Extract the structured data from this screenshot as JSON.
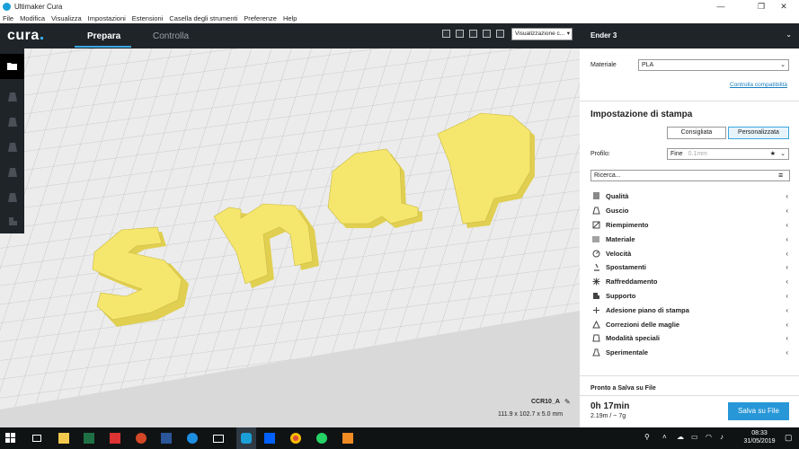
{
  "window": {
    "title": "Ultimaker Cura",
    "minimize": "—",
    "maximize": "❐",
    "close": "✕"
  },
  "menu": [
    "File",
    "Modifica",
    "Visualizza",
    "Impostazioni",
    "Estensioni",
    "Casella degli strumenti",
    "Preferenze",
    "Help"
  ],
  "header": {
    "logo": "cura",
    "stages": {
      "prepare": "Prepara",
      "monitor": "Controlla"
    },
    "view_select": "Visualizzazione c..."
  },
  "printer": {
    "name": "Ender 3"
  },
  "material": {
    "label": "Materiale",
    "value": "PLA",
    "compat_link": "Controlla compatibilità"
  },
  "print_setup": {
    "title": "Impostazione di stampa",
    "modes": {
      "recommended": "Consigliata",
      "custom": "Personalizzata"
    },
    "profile_label": "Profilo:",
    "profile_value": "Fine",
    "profile_extra": "0.1mm",
    "search_placeholder": "Ricerca...",
    "categories": [
      {
        "name": "Qualità",
        "icon": "quality-icon"
      },
      {
        "name": "Guscio",
        "icon": "shell-icon"
      },
      {
        "name": "Riempimento",
        "icon": "infill-icon"
      },
      {
        "name": "Materiale",
        "icon": "material-icon"
      },
      {
        "name": "Velocità",
        "icon": "speed-icon"
      },
      {
        "name": "Spostamenti",
        "icon": "travel-icon"
      },
      {
        "name": "Raffreddamento",
        "icon": "cooling-icon"
      },
      {
        "name": "Supporto",
        "icon": "support-icon"
      },
      {
        "name": "Adesione piano di stampa",
        "icon": "adhesion-icon"
      },
      {
        "name": "Correzioni delle maglie",
        "icon": "mesh-fix-icon"
      },
      {
        "name": "Modalità speciali",
        "icon": "special-modes-icon"
      },
      {
        "name": "Sperimentale",
        "icon": "experimental-icon"
      }
    ]
  },
  "status": {
    "title": "Pronto a Salva su File",
    "time": "0h 17min",
    "amount": "2.19m / ~ 7g",
    "save_button": "Salva su File"
  },
  "object": {
    "name": "CCR10_A",
    "dims": "111.9 x 102.7 x 5.0 mm"
  },
  "viewport": {
    "letters": [
      "s",
      "n",
      "a",
      "p"
    ],
    "model_color": "#f5e66d",
    "plate_color": "#e8e8e8"
  },
  "taskbar": {
    "time": "08:33",
    "date": "31/05/2019"
  },
  "colors": {
    "accent": "#2797d8",
    "header": "#1f2429"
  }
}
